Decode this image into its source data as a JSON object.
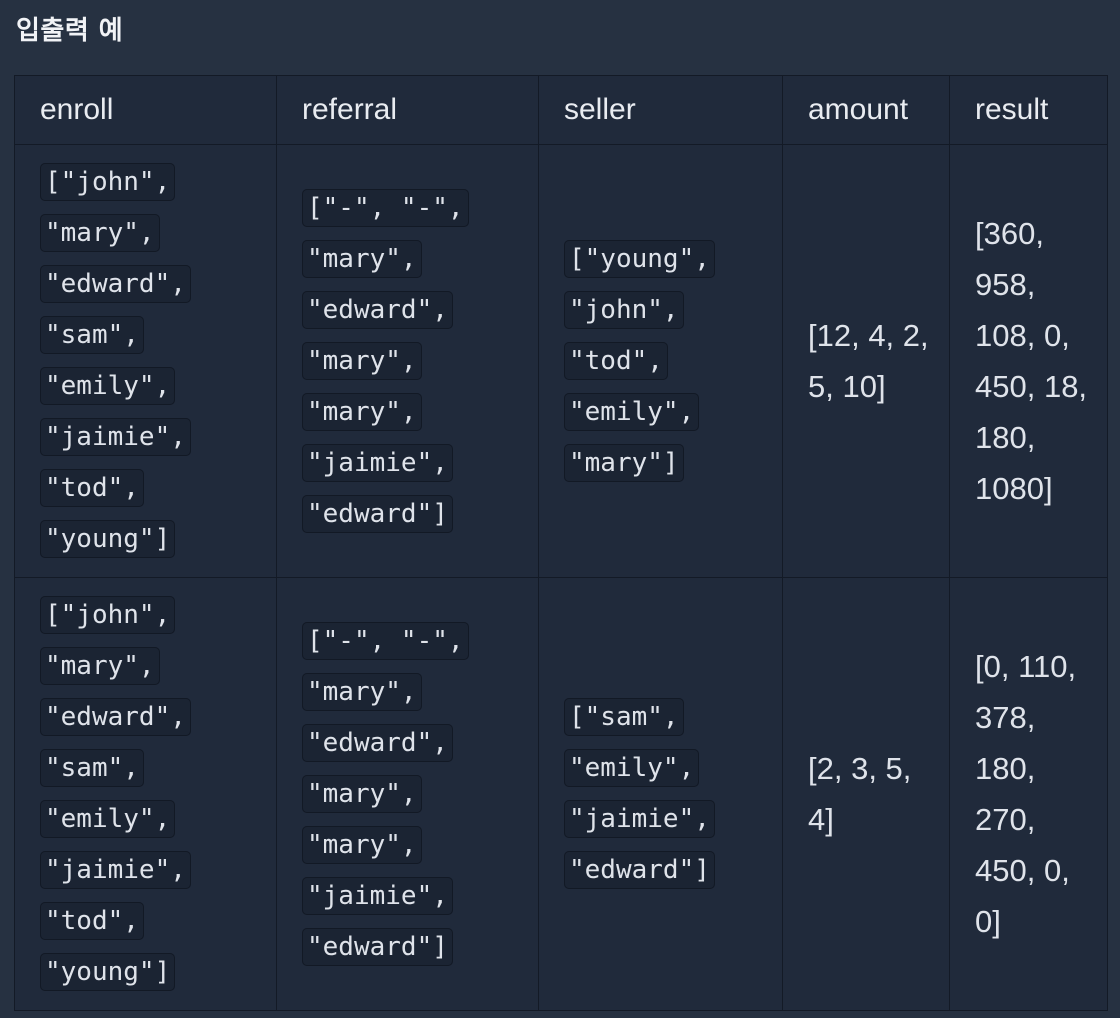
{
  "section": {
    "title": "입출력 예"
  },
  "table": {
    "headers": [
      "enroll",
      "referral",
      "seller",
      "amount",
      "result"
    ],
    "rows": [
      {
        "enroll": "[\"john\", \"mary\", \"edward\", \"sam\", \"emily\", \"jaimie\", \"tod\", \"young\"]",
        "referral": "[\"-\", \"-\", \"mary\", \"edward\", \"mary\", \"mary\", \"jaimie\", \"edward\"]",
        "seller": "[\"young\", \"john\", \"tod\", \"emily\", \"mary\"]",
        "amount": "[12, 4, 2, 5, 10]",
        "result": "[360, 958, 108, 0, 450, 18, 180, 1080]"
      },
      {
        "enroll": "[\"john\", \"mary\", \"edward\", \"sam\", \"emily\", \"jaimie\", \"tod\", \"young\"]",
        "referral": "[\"-\", \"-\", \"mary\", \"edward\", \"mary\", \"mary\", \"jaimie\", \"edward\"]",
        "seller": "[\"sam\", \"emily\", \"jaimie\", \"edward\"]",
        "amount": "[2, 3, 5, 4]",
        "result": "[0, 110, 378, 180, 270, 450, 0, 0]"
      }
    ]
  }
}
